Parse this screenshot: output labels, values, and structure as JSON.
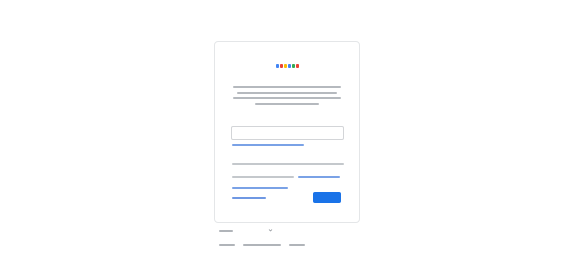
{
  "colors": {
    "primary": "#1a73e8",
    "link": "#1a73e8",
    "card_border": "#dadce0",
    "logo": [
      "#4285f4",
      "#ea4335",
      "#fbbc05",
      "#4285f4",
      "#34a853",
      "#ea4335"
    ]
  },
  "logo": {
    "text": ""
  },
  "signin": {
    "title": "",
    "description": "",
    "email_placeholder": "",
    "forgot_email_label": "",
    "privacy_notice": "",
    "privacy_link_label": "",
    "create_account_label": "",
    "next_button_label": ""
  },
  "footer": {
    "language_selected": "",
    "language_chevron_icon": "chevron-down-icon",
    "links": [
      "",
      "",
      ""
    ]
  }
}
